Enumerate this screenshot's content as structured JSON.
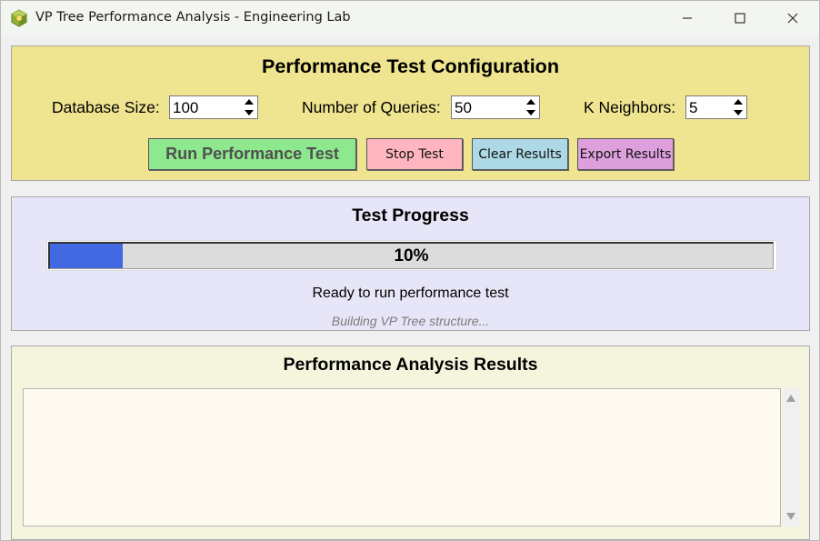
{
  "window": {
    "title": "VP Tree Performance Analysis - Engineering Lab",
    "icons": [
      "app-cube-icon",
      "minimize-icon",
      "maximize-icon",
      "close-icon"
    ]
  },
  "config": {
    "title": "Performance Test Configuration",
    "database_size_label": "Database Size:",
    "database_size_value": "100",
    "queries_label": "Number of Queries:",
    "queries_value": "50",
    "k_label": "K Neighbors:",
    "k_value": "5",
    "run_label": "Run Performance Test",
    "stop_label": "Stop Test",
    "clear_label": "Clear Results",
    "export_label": "Export Results",
    "colors": {
      "panel": "#efe490",
      "run": "#8ee88e",
      "stop": "#ffb6c1",
      "clear": "#add8e6",
      "export": "#dda0dd"
    }
  },
  "progress": {
    "title": "Test Progress",
    "percent": 10,
    "percent_text": "10%",
    "status": "Ready to run performance test",
    "substatus": "Building VP Tree structure...",
    "colors": {
      "panel": "#e6e6f8",
      "fill": "#4169e1"
    }
  },
  "results": {
    "title": "Performance Analysis Results",
    "content": "",
    "colors": {
      "panel": "#f5f5dd",
      "textarea": "#fffaef"
    }
  }
}
